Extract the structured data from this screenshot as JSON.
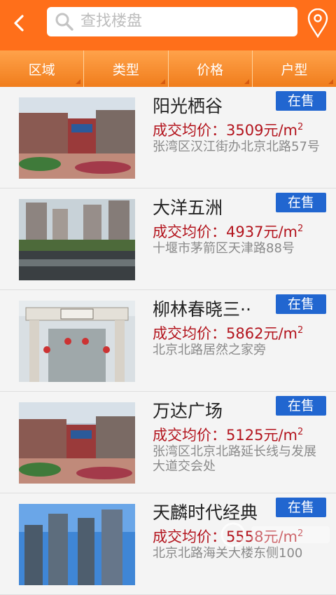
{
  "header": {
    "back_icon": "chevron-left-icon",
    "search_icon": "search-icon",
    "search_placeholder": "查找楼盘",
    "location_icon": "map-pin-icon"
  },
  "filters": [
    {
      "label": "区域"
    },
    {
      "label": "类型"
    },
    {
      "label": "价格"
    },
    {
      "label": "户型"
    }
  ],
  "listings": [
    {
      "name": "阳光栖谷",
      "status": "在售",
      "price_prefix": "成交均价：",
      "price_value": "3509元/m",
      "price_sup": "2",
      "address": "张湾区汉江街办北京北路57号"
    },
    {
      "name": "大洋五洲",
      "status": "在售",
      "price_prefix": "成交均价：",
      "price_value": "4937元/m",
      "price_sup": "2",
      "address": "十堰市茅箭区天津路88号"
    },
    {
      "name": "柳林春晓三··",
      "status": "在售",
      "price_prefix": "成交均价：",
      "price_value": "5862元/m",
      "price_sup": "2",
      "address": "北京北路居然之家旁"
    },
    {
      "name": "万达广场",
      "status": "在售",
      "price_prefix": "成交均价：",
      "price_value": "5125元/m",
      "price_sup": "2",
      "address": "张湾区北京北路延长线与发展大道交会处"
    },
    {
      "name": "天麟时代经典",
      "status": "在售",
      "price_prefix": "成交均价：",
      "price_value": "5558元/m",
      "price_sup": "2",
      "address": "北京北路海关大楼东侧100"
    }
  ],
  "theme": {
    "accent": "#ff6f1a",
    "badge": "#2166d0",
    "price": "#b3141d"
  }
}
